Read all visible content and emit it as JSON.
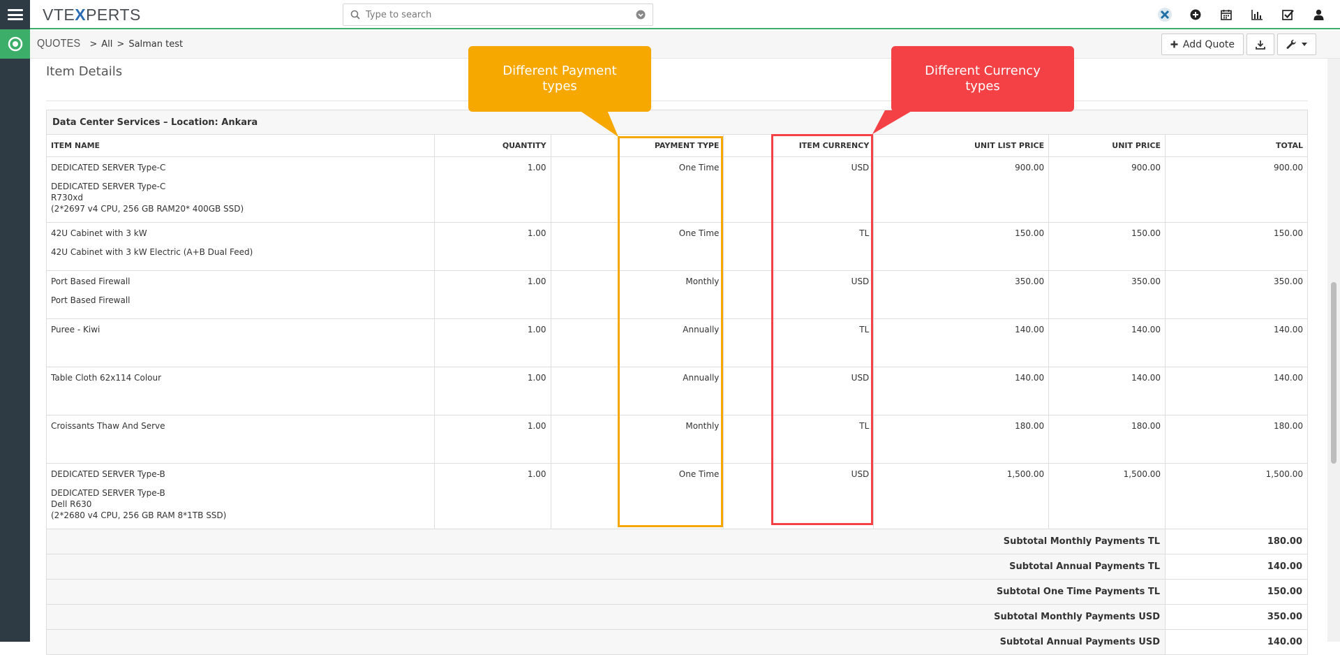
{
  "app": {
    "logo_prefix": "VTE",
    "logo_x": "X",
    "logo_suffix": "PERTS"
  },
  "search": {
    "placeholder": "Type to search"
  },
  "breadcrumb": {
    "module": "QUOTES",
    "sep1": ">",
    "filter": "All",
    "sep2": ">",
    "record": "Salman test"
  },
  "actions": {
    "add_quote": "Add Quote"
  },
  "section": {
    "title": "Item Details"
  },
  "callouts": {
    "payment": "Different Payment types",
    "currency": "Different Currency types"
  },
  "table": {
    "group_label": "Data Center Services – Location: Ankara",
    "headers": {
      "item_name": "ITEM NAME",
      "quantity": "QUANTITY",
      "payment_type": "PAYMENT TYPE",
      "item_currency": "ITEM CURRENCY",
      "unit_list_price": "UNIT LIST PRICE",
      "unit_price": "UNIT PRICE",
      "total": "TOTAL"
    },
    "rows": [
      {
        "name": "DEDICATED SERVER Type-C",
        "desc1": "DEDICATED SERVER Type-C",
        "desc2": "R730xd",
        "desc3": "(2*2697 v4 CPU, 256 GB RAM20* 400GB SSD)",
        "qty": "1.00",
        "payment": "One Time",
        "currency": "USD",
        "list_price": "900.00",
        "unit_price": "900.00",
        "total": "900.00"
      },
      {
        "name": "42U Cabinet with 3 kW",
        "desc1": "42U Cabinet with 3 kW Electric (A+B Dual Feed)",
        "desc2": "",
        "desc3": "",
        "qty": "1.00",
        "payment": "One Time",
        "currency": "TL",
        "list_price": "150.00",
        "unit_price": "150.00",
        "total": "150.00"
      },
      {
        "name": "Port Based Firewall",
        "desc1": "Port Based Firewall",
        "desc2": "",
        "desc3": "",
        "qty": "1.00",
        "payment": "Monthly",
        "currency": "USD",
        "list_price": "350.00",
        "unit_price": "350.00",
        "total": "350.00"
      },
      {
        "name": "Puree - Kiwi",
        "desc1": "",
        "desc2": "",
        "desc3": "",
        "qty": "1.00",
        "payment": "Annually",
        "currency": "TL",
        "list_price": "140.00",
        "unit_price": "140.00",
        "total": "140.00"
      },
      {
        "name": "Table Cloth 62x114 Colour",
        "desc1": "",
        "desc2": "",
        "desc3": "",
        "qty": "1.00",
        "payment": "Annually",
        "currency": "USD",
        "list_price": "140.00",
        "unit_price": "140.00",
        "total": "140.00"
      },
      {
        "name": "Croissants Thaw And Serve",
        "desc1": "",
        "desc2": "",
        "desc3": "",
        "qty": "1.00",
        "payment": "Monthly",
        "currency": "TL",
        "list_price": "180.00",
        "unit_price": "180.00",
        "total": "180.00"
      },
      {
        "name": "DEDICATED SERVER Type-B",
        "desc1": "DEDICATED SERVER Type-B",
        "desc2": "Dell R630",
        "desc3": "(2*2680 v4 CPU, 256 GB RAM 8*1TB SSD)",
        "qty": "1.00",
        "payment": "One Time",
        "currency": "USD",
        "list_price": "1,500.00",
        "unit_price": "1,500.00",
        "total": "1,500.00"
      }
    ],
    "subtotals": [
      {
        "label": "Subtotal Monthly Payments TL",
        "value": "180.00"
      },
      {
        "label": "Subtotal Annual Payments TL",
        "value": "140.00"
      },
      {
        "label": "Subtotal One Time Payments TL",
        "value": "150.00"
      },
      {
        "label": "Subtotal Monthly Payments USD",
        "value": "350.00"
      },
      {
        "label": "Subtotal Annual Payments USD",
        "value": "140.00"
      }
    ]
  },
  "colors": {
    "accent": "#3cae6a",
    "payment_highlight": "#f6a800",
    "currency_highlight": "#f44146",
    "sidebar": "#2f3b44"
  }
}
